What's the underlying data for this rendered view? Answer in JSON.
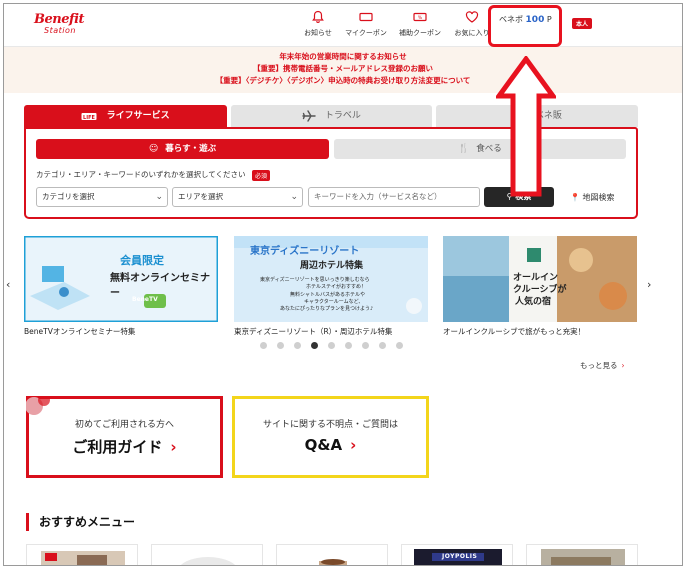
{
  "header": {
    "logo_main": "Benefit",
    "logo_sub": "Station",
    "nav": [
      {
        "label": "お知らせ",
        "icon": "bell-icon"
      },
      {
        "label": "マイクーポン",
        "icon": "ticket-icon"
      },
      {
        "label": "補助クーポン",
        "icon": "coupon-icon"
      },
      {
        "label": "お気に入り",
        "icon": "heart-icon"
      }
    ],
    "points_label": "ベネポ",
    "points_value": "100",
    "points_unit": "P",
    "user_badge": "本人"
  },
  "notices": [
    "年末年始の営業時間に関するお知らせ",
    "【重要】携帯電話番号・メールアドレス登録のお願い",
    "【重要】〈デジチケ〉〈デジボン〉申込時の特典お受け取り方法変更について"
  ],
  "tabs": [
    {
      "label": "ライフサービス",
      "active": true
    },
    {
      "label": "トラベル",
      "active": false
    },
    {
      "label": "ベネ販",
      "active": false
    }
  ],
  "search": {
    "subtabs": [
      {
        "label": "暮らす・遊ぶ",
        "active": true
      },
      {
        "label": "食べる",
        "active": false
      }
    ],
    "hint": "カテゴリ・エリア・キーワードのいずれかを選択してください",
    "required_badge": "必須",
    "category_select": "カテゴリを選択",
    "area_select": "エリアを選択",
    "keyword_placeholder": "キーワードを入力（サービス名など）",
    "search_button": "検索",
    "map_search": "地図検索"
  },
  "carousel": {
    "slides": [
      {
        "caption": "BeneTVオンラインセミナー特集",
        "banner_line1": "会員限定",
        "banner_line2": "無料オンラインセミナー",
        "banner_logo": "BeneTV"
      },
      {
        "caption": "東京ディズニーリゾート（R）・周辺ホテル特集",
        "banner_title": "東京ディズニーリゾート",
        "banner_sub": "周辺ホテル特集",
        "banner_text": [
          "東京ディズニーリゾートを思いっきり楽しむなら",
          "ホテルステイがおすすめ！",
          "無料シャトルバスがあるホテルや",
          "キャラクタールームなど、",
          "あなたにぴったりなプランを見つけよう♪"
        ]
      },
      {
        "caption": "オールインクルーシブで旅がもっと充実！",
        "banner_line1": "オールイン",
        "banner_line2": "クルーシブが",
        "banner_line3": "人気の宿"
      }
    ],
    "dot_count": 9,
    "active_dot": 3,
    "more_label": "もっと見る"
  },
  "guides": [
    {
      "small": "初めてご利用される方へ",
      "big": "ご利用ガイド"
    },
    {
      "small": "サイトに関する不明点・ご質問は",
      "big": "Q&A"
    }
  ],
  "recommend": {
    "title": "おすすめメニュー",
    "card_labels": [
      "",
      "",
      "",
      "JOYPOLIS",
      ""
    ]
  },
  "colors": {
    "brand_red": "#d90f1b",
    "points_blue": "#2a64c8",
    "notice_bg": "#fbf3ec",
    "qa_yellow": "#f3d51b",
    "annotation_red": "#e8121f"
  }
}
